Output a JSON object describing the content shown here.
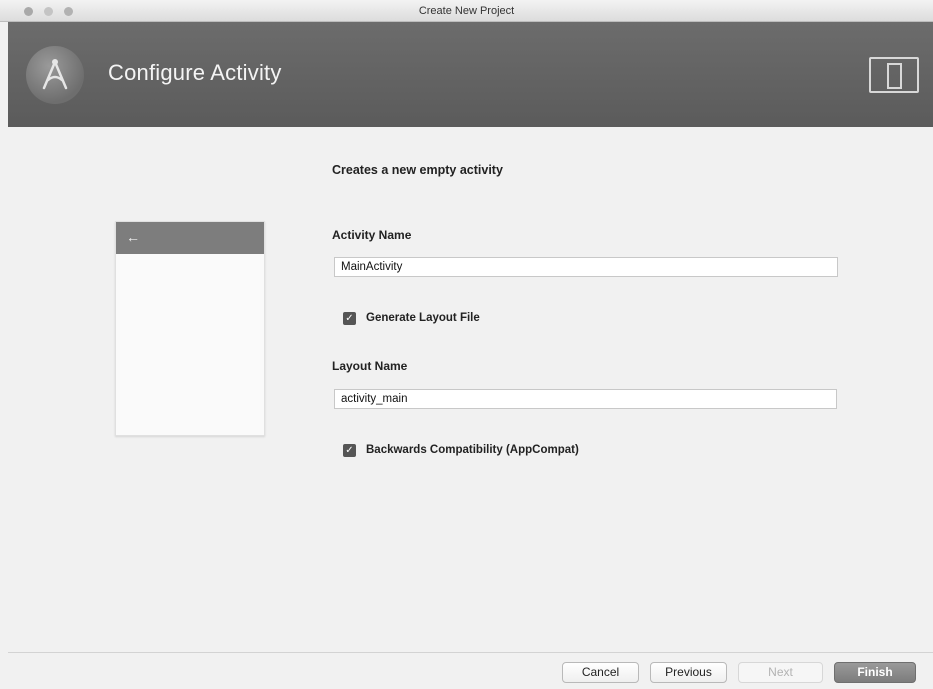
{
  "window": {
    "title": "Create New Project"
  },
  "header": {
    "title": "Configure Activity",
    "logo_icon": "android-studio-icon",
    "device_icon": "device-preview-icon"
  },
  "preview": {
    "back_icon": "←"
  },
  "form": {
    "description": "Creates a new empty activity",
    "activity_name_label": "Activity Name",
    "activity_name_value": "MainActivity",
    "generate_layout_label": "Generate Layout File",
    "generate_layout_checked": true,
    "layout_name_label": "Layout Name",
    "layout_name_value": "activity_main",
    "backwards_compat_label": "Backwards Compatibility (AppCompat)",
    "backwards_compat_checked": true
  },
  "footer": {
    "cancel_label": "Cancel",
    "previous_label": "Previous",
    "next_label": "Next",
    "finish_label": "Finish"
  },
  "colors": {
    "header": "#5f5f5f",
    "primary_button": "#8a8a8a"
  }
}
